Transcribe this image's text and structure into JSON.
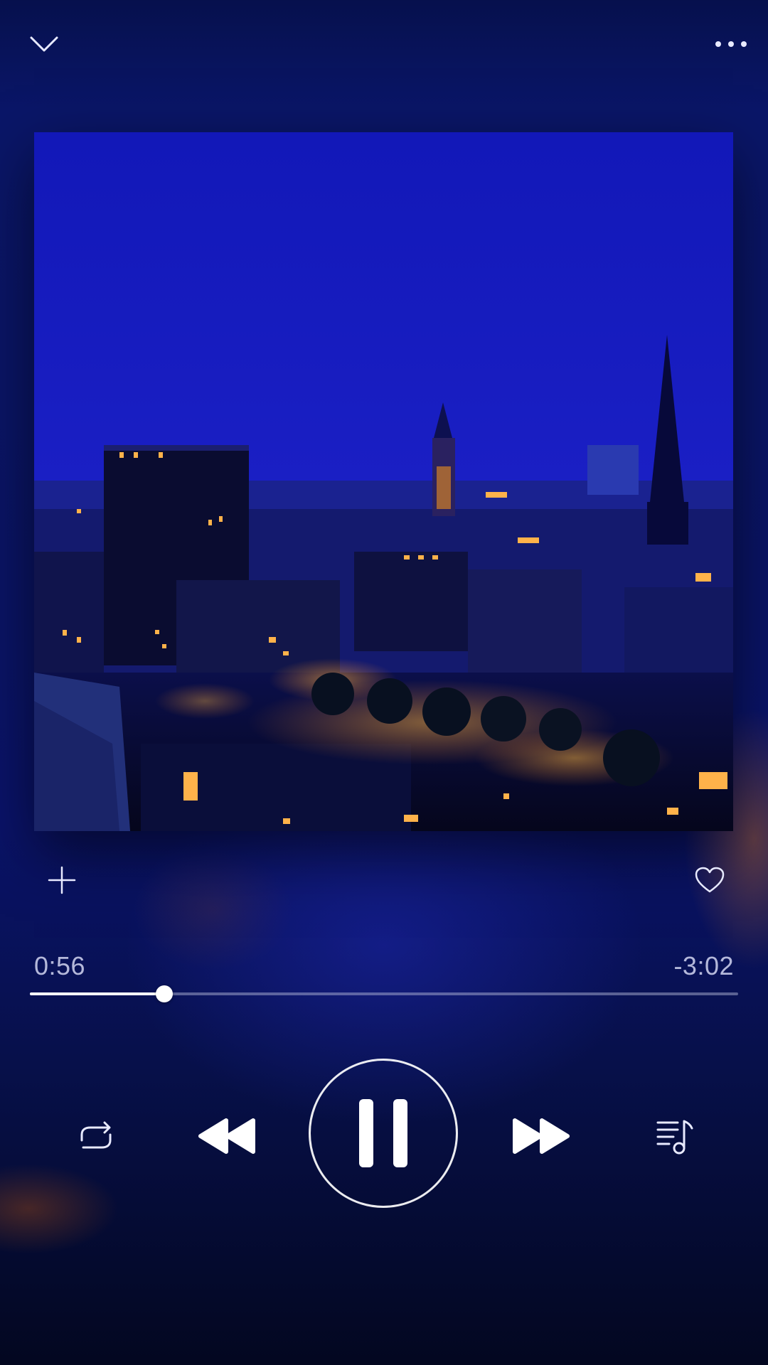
{
  "header": {
    "collapse_icon": "chevron-down-icon",
    "more_icon": "more-horizontal-icon"
  },
  "artwork": {
    "description_icon": "album-art"
  },
  "actions": {
    "add_icon": "plus-icon",
    "like_icon": "heart-icon"
  },
  "playback": {
    "elapsed": "0:56",
    "remaining": "-3:02",
    "progress_fraction": 0.19
  },
  "controls": {
    "repeat_icon": "repeat-icon",
    "previous_icon": "rewind-icon",
    "play_pause_icon": "pause-icon",
    "next_icon": "fast-forward-icon",
    "queue_icon": "playlist-music-icon"
  },
  "colors": {
    "background": "#0a1466",
    "foreground": "#ffffff",
    "track": "#bec3e1"
  }
}
